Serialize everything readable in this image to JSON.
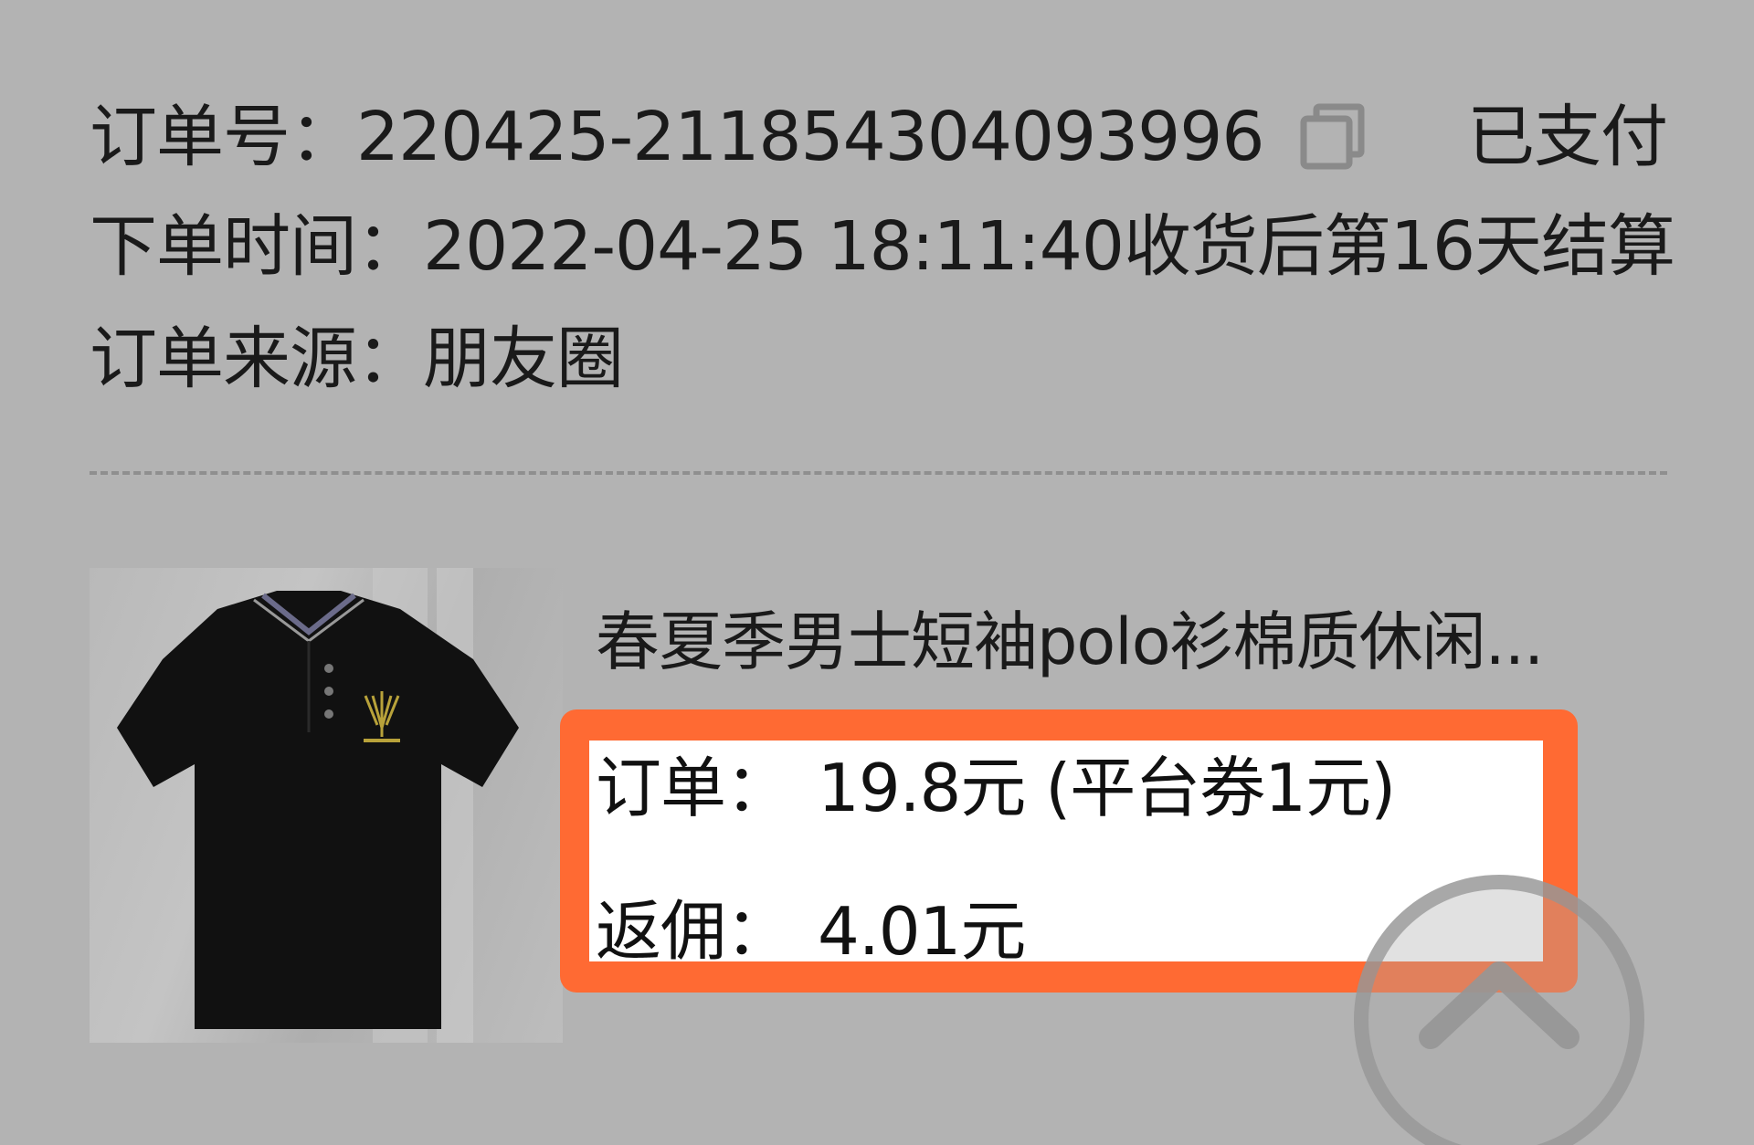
{
  "order": {
    "number_label": "订单号：",
    "number_value": "220425-211854304093996",
    "status": "已支付",
    "time_label": "下单时间：",
    "time_value": "2022-04-25 18:11:40",
    "settlement": "收货后第16天结算",
    "source_label": "订单来源：",
    "source_value": "朋友圈"
  },
  "product": {
    "title": "春夏季男士短袖polo衫棉质休闲...",
    "image_icon": "polo-shirt-image"
  },
  "summary": {
    "order_label": "订单：",
    "order_value": "19.8元 (平台券1元)",
    "commission_label": "返佣：",
    "commission_value": "4.01元"
  },
  "colors": {
    "background": "#b3b3b3",
    "highlight_border": "#ff6a33",
    "highlight_fill": "#ffffff"
  },
  "icons": {
    "copy": "copy-icon",
    "scroll_top": "chevron-up-icon"
  }
}
